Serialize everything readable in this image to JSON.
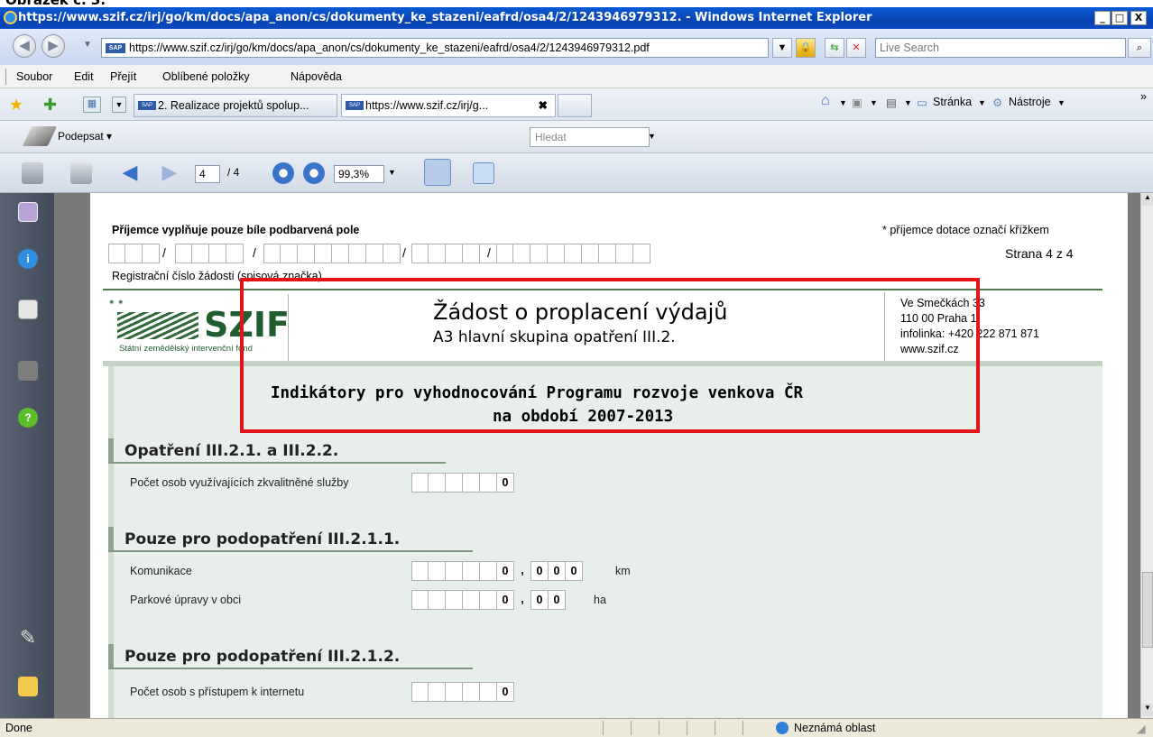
{
  "caption": "Obrázek č. 3.",
  "window": {
    "title": "https://www.szif.cz/irj/go/km/docs/apa_anon/cs/dokumenty_ke_stazeni/eafrd/osa4/2/1243946979312. - Windows Internet Explorer",
    "min": "_",
    "max": "□",
    "close": "X"
  },
  "address": {
    "url": "https://www.szif.cz/irj/go/km/docs/apa_anon/cs/dokumenty_ke_stazeni/eafrd/osa4/2/1243946979312.pdf",
    "search_placeholder": "Live Search"
  },
  "menu": [
    "Soubor",
    "Edit",
    "Přejít",
    "Oblíbené položky",
    "Nápověda"
  ],
  "tabs": [
    {
      "label": "2. Realizace projektů spolup..."
    },
    {
      "label": "https://www.szif.cz/irj/g..."
    }
  ],
  "commands": {
    "page": "Stránka",
    "tools": "Nástroje",
    "more": "»"
  },
  "acrobat": {
    "sign": "Podepsat",
    "search_placeholder": "Hledat",
    "page_current": "4",
    "page_total": "/ 4",
    "zoom": "99,3%"
  },
  "doc": {
    "top_left": "Příjemce vyplňuje pouze bíle podbarvená pole",
    "top_right": "* příjemce dotace označí křížkem",
    "page_label": "Strana 4 z 4",
    "reg_label": "Registrační číslo žádosti (spisová značka)",
    "logo_text": "SZIF",
    "logo_sub": "Státní zemědělský intervenční fond",
    "header_title": "Žádost o proplacení výdajů",
    "header_sub": "A3 hlavní skupina opatření III.2.",
    "address_lines": [
      "Ve Smečkách 33",
      "110 00 Praha 1",
      "infolinka: +420 222 871 871",
      "www.szif.cz"
    ],
    "indicator_title_1": "Indikátory pro vyhodnocování Programu rozvoje venkova ČR",
    "indicator_title_2": "na období 2007-2013",
    "section1": "Opatření III.2.1. a III.2.2.",
    "field_persons": "Počet osob využívajících zkvalitněné služby",
    "section2": "Pouze pro podopatření III.2.1.1.",
    "field_roads": "Komunikace",
    "unit_km": "km",
    "field_parks": "Parkové úpravy v obci",
    "unit_ha": "ha",
    "section3": "Pouze pro podopatření III.2.1.2.",
    "field_internet": "Počet osob s přístupem k internetu",
    "zero": "0",
    "comma": ","
  },
  "status": {
    "left": "Done",
    "zone": "Neznámá oblast"
  },
  "colors": {
    "highlight": "#e4131b",
    "ie_title": "#0a4fc8",
    "page_green": "#e8eeea"
  }
}
